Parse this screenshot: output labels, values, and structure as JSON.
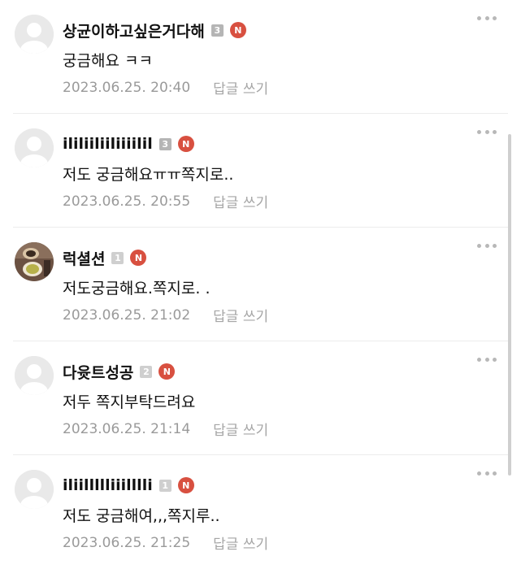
{
  "comments": [
    {
      "author": "상균이하고싶은거다해",
      "level": "3",
      "new_badge": "N",
      "text": "궁금해요 ㅋㅋ",
      "date": "2023.06.25. 20:40",
      "reply": "답글 쓰기"
    },
    {
      "author": "ililiiliiliiiilil",
      "level": "3",
      "new_badge": "N",
      "text": "저도 궁금해요ㅠㅠ쪽지로..",
      "date": "2023.06.25. 20:55",
      "reply": "답글 쓰기"
    },
    {
      "author": "럭셜션",
      "level": "1",
      "new_badge": "N",
      "text": "저도궁금해요.쪽지로. .",
      "date": "2023.06.25. 21:02",
      "reply": "답글 쓰기"
    },
    {
      "author": "다윳트성공",
      "level": "2",
      "new_badge": "N",
      "text": "저두 쪽지부탁드려요",
      "date": "2023.06.25. 21:14",
      "reply": "답글 쓰기"
    },
    {
      "author": "iliillllliiilllli",
      "level": "1",
      "new_badge": "N",
      "text": "저도 궁금해여,,,쪽지루..",
      "date": "2023.06.25. 21:25",
      "reply": "답글 쓰기"
    }
  ],
  "icons": {
    "avatar_default": "person-silhouette-icon",
    "avatar_photo": "food-photo-avatar",
    "more": "more-dots-icon"
  },
  "colors": {
    "new_badge": "#d85040",
    "level_badge": "#b5b5b5",
    "meta_text": "#9a9a9a",
    "divider": "#ececec"
  }
}
